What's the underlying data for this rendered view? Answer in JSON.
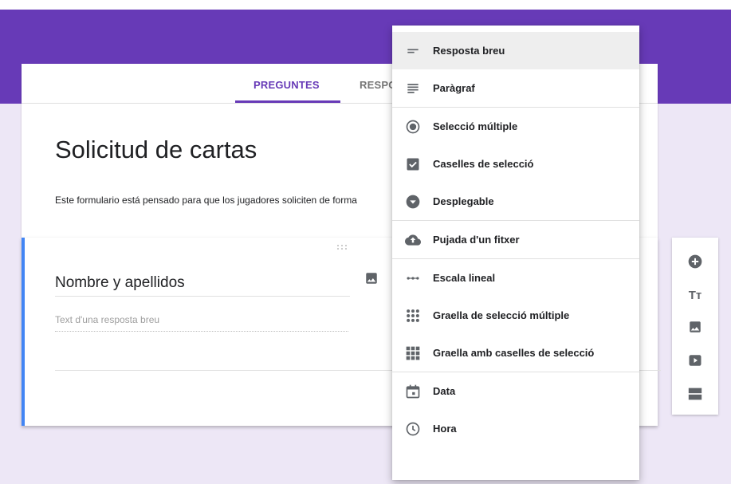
{
  "tabs": [
    {
      "label": "PREGUNTES",
      "active": true
    },
    {
      "label": "RESPOSTES",
      "active": false
    }
  ],
  "form": {
    "title": "Solicitud de cartas",
    "description": "Este formulario está pensado para que los jugadores soliciten de forma"
  },
  "question": {
    "title": "Nombre y apellidos",
    "answer_placeholder": "Text d'una resposta breu"
  },
  "menu": {
    "items": [
      {
        "label": "Resposta breu",
        "icon": "short-answer-icon",
        "selected": true
      },
      {
        "label": "Paràgraf",
        "icon": "paragraph-icon"
      },
      {
        "label": "Selecció múltiple",
        "icon": "radio-button-icon"
      },
      {
        "label": "Caselles de selecció",
        "icon": "checkbox-icon"
      },
      {
        "label": "Desplegable",
        "icon": "dropdown-icon"
      },
      {
        "label": "Pujada d'un fitxer",
        "icon": "cloud-upload-icon"
      },
      {
        "label": "Escala lineal",
        "icon": "linear-scale-icon"
      },
      {
        "label": "Graella de selecció múltiple",
        "icon": "dots-grid-icon"
      },
      {
        "label": "Graella amb caselles de selecció",
        "icon": "checkbox-grid-icon"
      },
      {
        "label": "Data",
        "icon": "calendar-icon"
      },
      {
        "label": "Hora",
        "icon": "clock-icon"
      }
    ]
  },
  "toolbar": {
    "items": [
      "add-question-icon",
      "add-title-icon",
      "add-image-icon",
      "add-video-icon",
      "add-section-icon"
    ],
    "title_glyph": "Tт"
  },
  "colors": {
    "accent": "#673ab7",
    "background": "#ede7f6",
    "question_highlight": "#4285f4",
    "icon": "#5f6368"
  }
}
